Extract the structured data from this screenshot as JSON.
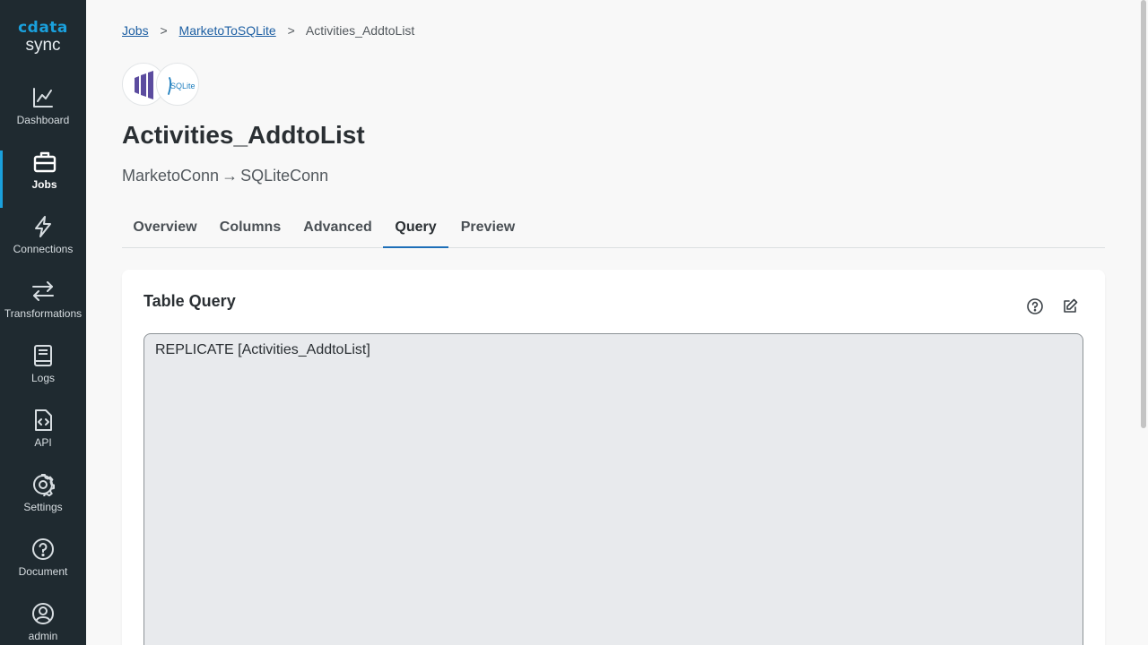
{
  "app": {
    "logo_top": "cdata",
    "logo_bottom": "sync"
  },
  "sidebar": {
    "items": [
      {
        "label": "Dashboard",
        "icon": "chart-line-icon",
        "active": false
      },
      {
        "label": "Jobs",
        "icon": "briefcase-icon",
        "active": true
      },
      {
        "label": "Connections",
        "icon": "bolt-icon",
        "active": false
      },
      {
        "label": "Transformations",
        "icon": "swap-arrows-icon",
        "active": false
      },
      {
        "label": "Logs",
        "icon": "book-icon",
        "active": false
      },
      {
        "label": "API",
        "icon": "code-file-icon",
        "active": false
      },
      {
        "label": "Settings",
        "icon": "gear-icon",
        "active": false
      },
      {
        "label": "Document",
        "icon": "question-circle-icon",
        "active": false
      },
      {
        "label": "admin",
        "icon": "user-circle-icon",
        "active": false
      }
    ]
  },
  "breadcrumb": {
    "items": [
      {
        "label": "Jobs",
        "link": true
      },
      {
        "label": "MarketoToSQLite",
        "link": true
      },
      {
        "label": "Activities_AddtoList",
        "link": false
      }
    ],
    "separator": ">"
  },
  "connectors": {
    "source_icon": "marketo-logo-icon",
    "destination_icon": "sqlite-logo-icon",
    "destination_text": "SQLite"
  },
  "page": {
    "title": "Activities_AddtoList",
    "source": "MarketoConn",
    "arrow": "→",
    "destination": "SQLiteConn"
  },
  "tabs": [
    {
      "label": "Overview",
      "active": false
    },
    {
      "label": "Columns",
      "active": false
    },
    {
      "label": "Advanced",
      "active": false
    },
    {
      "label": "Query",
      "active": true
    },
    {
      "label": "Preview",
      "active": false
    }
  ],
  "card": {
    "title": "Table Query",
    "help_icon": "help-circle-icon",
    "edit_icon": "edit-icon",
    "query": "REPLICATE [Activities_AddtoList]"
  },
  "colors": {
    "sidebar_bg": "#1f2a30",
    "accent": "#1aa0dc",
    "link": "#1d5fa3",
    "tab_active_underline": "#1d6fb8",
    "marketo_purple": "#5c4c9f"
  }
}
